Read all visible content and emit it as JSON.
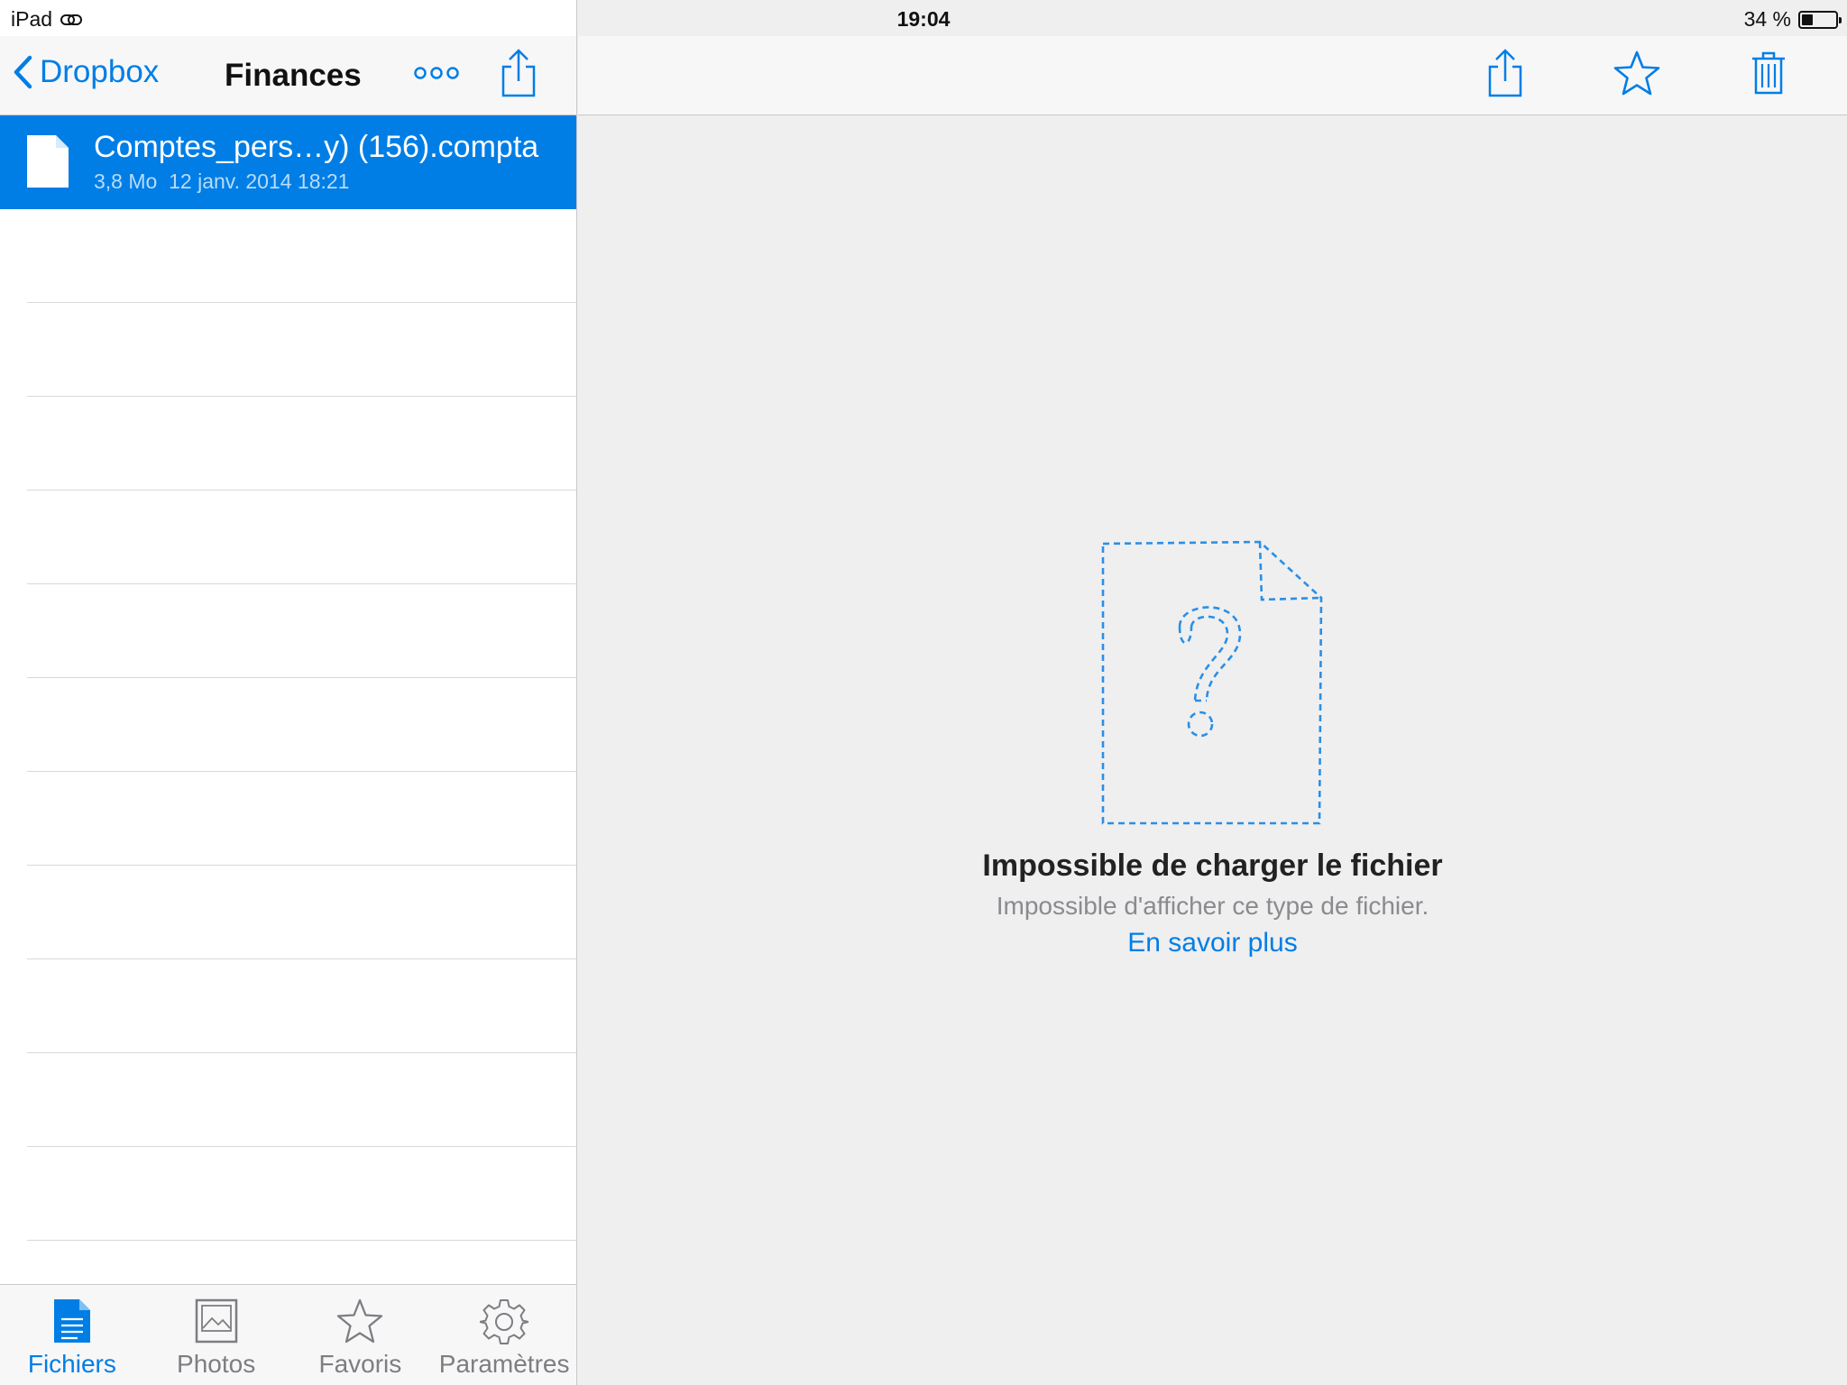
{
  "status_bar": {
    "device": "iPad",
    "time": "19:04",
    "battery_text": "34 %",
    "battery_level": 0.34
  },
  "left_nav": {
    "back_label": "Dropbox",
    "title": "Finances"
  },
  "files": [
    {
      "name": "Comptes_pers…y) (156).compta",
      "size": "3,8 Mo",
      "date": "12 janv. 2014 18:21"
    }
  ],
  "preview": {
    "title": "Impossible de charger le fichier",
    "subtitle": "Impossible d'afficher ce type de fichier.",
    "link": "En savoir plus"
  },
  "tabs": [
    {
      "label": "Fichiers",
      "icon": "document-icon",
      "active": true
    },
    {
      "label": "Photos",
      "icon": "photo-icon",
      "active": false
    },
    {
      "label": "Favoris",
      "icon": "star-icon",
      "active": false
    },
    {
      "label": "Paramètres",
      "icon": "gear-icon",
      "active": false
    }
  ],
  "colors": {
    "accent": "#007ee5",
    "selection": "#007ee5",
    "background": "#efeff0"
  }
}
